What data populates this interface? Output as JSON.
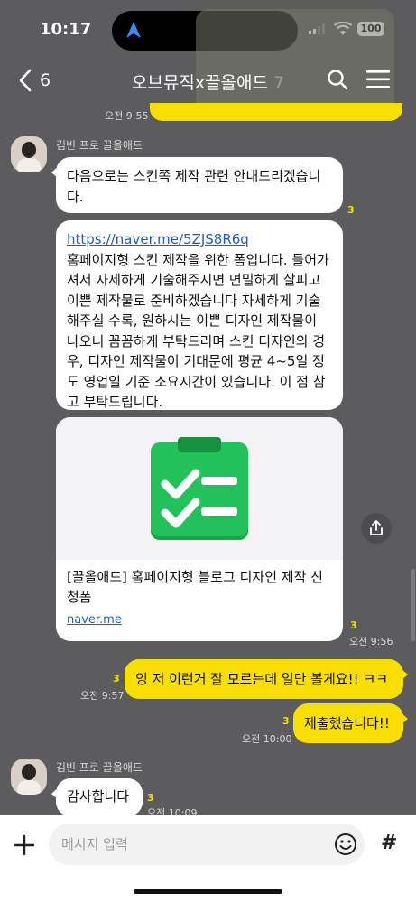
{
  "status": {
    "time": "10:17",
    "battery": "100"
  },
  "header": {
    "back_count": "6",
    "title": "오브뮤직x끌올애드",
    "member_count": "7"
  },
  "previous": {
    "time": "오전 9:55"
  },
  "messages": [
    {
      "sender": "김빈 프로 끌올애드",
      "text1": "다음으로는 스킨쪽 제작 관련 안내드리겠습니다.",
      "unread1": "3",
      "link": "https://naver.me/5ZJS8R6q",
      "text2": "홈페이지형 스킨 제작을 위한 폼입니다. 들어가셔서 자세하게 기술해주시면 면밀하게 살피고 이쁜 제작물로 준비하겠습니다 자세하게 기술해주실 수록, 원하시는 이쁜 디자인 제작물이 나오니 꼼꼼하게 부탁드리며 스킨 디자인의 경우, 디자인 제작물이 기대문에 평균 4~5일 정도 영업일 기준 소요시간이 있습니다. 이 점 참고 부탁드립니다.",
      "card_title": "[끌올애드] 홈페이지형 블로그 디자인 제작 신청폼",
      "card_domain": "naver.me",
      "unread2": "3",
      "time": "오전 9:56"
    },
    {
      "text": "잉 저 이런거 잘 모르는데 일단 볼게요!! ㅋㅋ",
      "unread": "3",
      "time": "오전 9:57"
    },
    {
      "text": "제출했습니다!!",
      "unread": "3",
      "time": "오전 10:00"
    },
    {
      "sender": "김빈 프로 끌올애드",
      "text": "감사합니다",
      "unread": "3",
      "time": "오전 10:09"
    }
  ],
  "input": {
    "placeholder": "메시지 입력"
  },
  "icons": {
    "back": "chevron-left-icon",
    "search": "search-icon",
    "menu": "hamburger-icon",
    "share": "share-icon",
    "plus": "plus-icon",
    "emoji": "emoji-icon",
    "hash": "hashtag-icon"
  },
  "colors": {
    "background": "#5c5c5e",
    "my_bubble": "#f8df00",
    "other_bubble": "#ffffff",
    "unread": "#f8df00",
    "link": "#1f5fb8"
  }
}
